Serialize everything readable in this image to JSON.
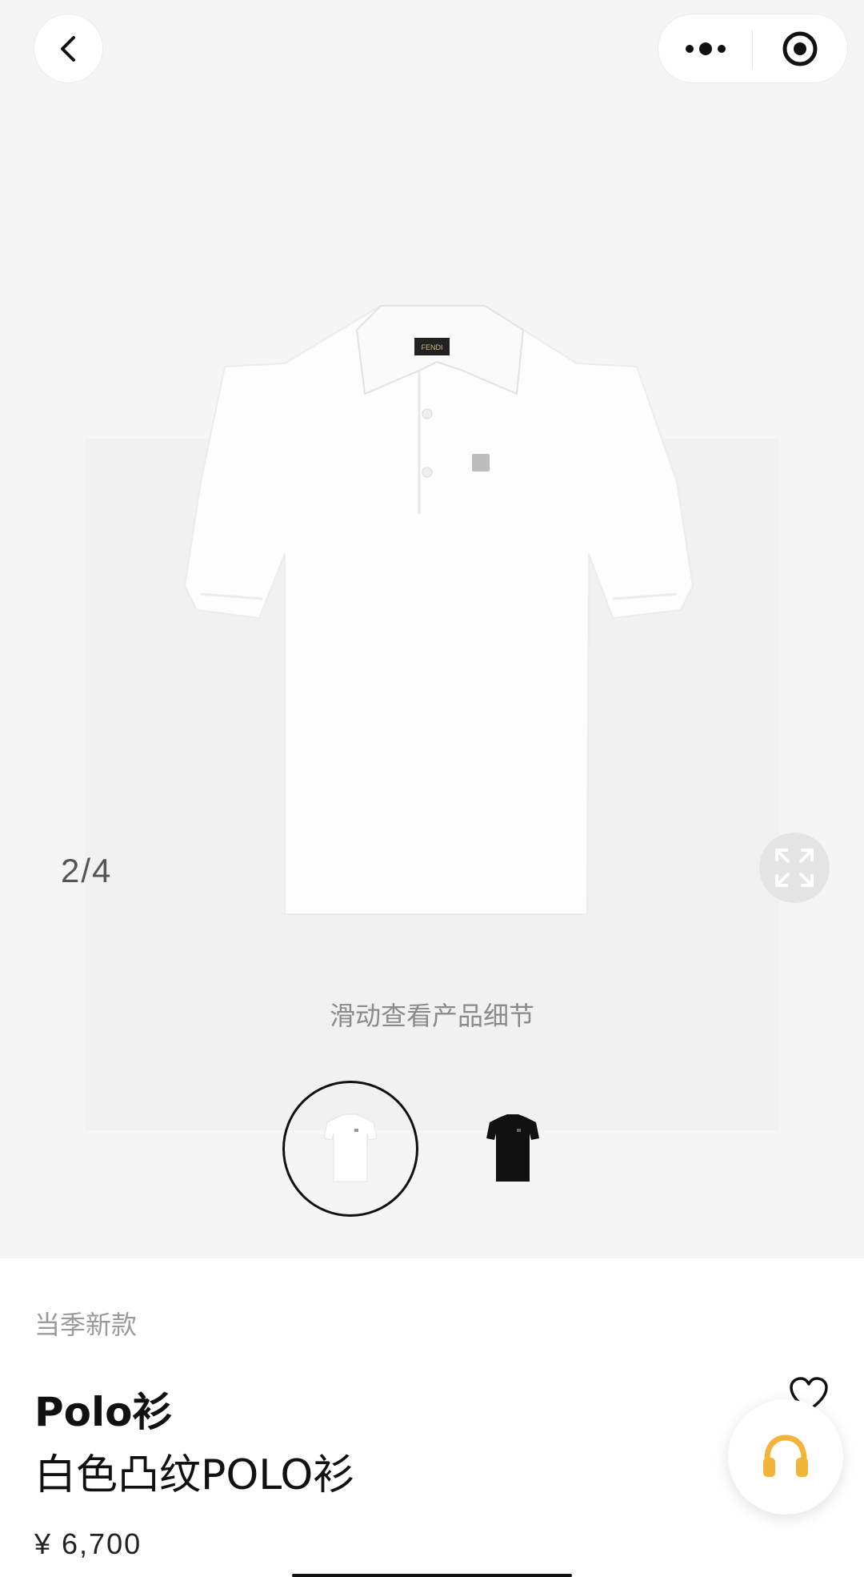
{
  "nav": {
    "back_icon": "chevron-left-icon",
    "more_icon": "more-dots-icon",
    "target_icon": "record-target-icon"
  },
  "gallery": {
    "counter": "2/4",
    "swipe_hint": "滑动查看产品细节",
    "expand_icon": "expand-arrows-icon",
    "thumbnails": [
      {
        "label": "white",
        "color": "#ffffff",
        "selected": true
      },
      {
        "label": "black",
        "color": "#111111",
        "selected": false
      }
    ]
  },
  "product": {
    "season_tag": "当季新款",
    "category": "Polo衫",
    "name": "白色凸纹POLO衫",
    "price": "¥ 6,700",
    "label_text": "FENDI"
  },
  "actions": {
    "favorite_icon": "heart-icon",
    "share_icon": "share-icon",
    "support_icon": "headphones-icon",
    "accent_color": "#f2b53a"
  }
}
